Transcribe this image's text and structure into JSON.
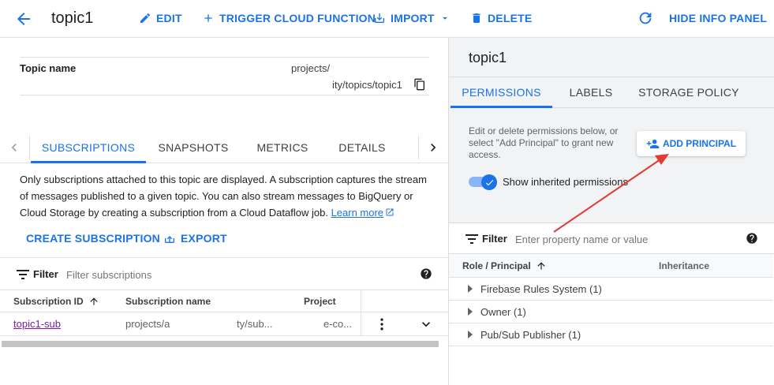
{
  "header": {
    "title": "topic1",
    "edit_label": "EDIT",
    "trigger_label": "TRIGGER CLOUD FUNCTION",
    "import_label": "IMPORT",
    "delete_label": "DELETE",
    "hide_info_label": "HIDE INFO PANEL"
  },
  "topic": {
    "name_label": "Topic name",
    "path_line1": "projects/",
    "path_line2": "ity/topics/topic1"
  },
  "tabs": [
    {
      "label": "SUBSCRIPTIONS"
    },
    {
      "label": "SNAPSHOTS"
    },
    {
      "label": "METRICS"
    },
    {
      "label": "DETAILS"
    }
  ],
  "subscriptions": {
    "description": "Only subscriptions attached to this topic are displayed. A subscription captures the stream of messages published to a given topic. You can also stream messages to BigQuery or Cloud Storage by creating a subscription from a Cloud Dataflow job.",
    "learn_more": "Learn more",
    "create_label": "CREATE SUBSCRIPTION",
    "export_label": "EXPORT",
    "filter_label": "Filter",
    "filter_placeholder": "Filter subscriptions",
    "columns": {
      "id": "Subscription ID",
      "name": "Subscription name",
      "project": "Project"
    },
    "rows": [
      {
        "id": "topic1-sub",
        "name_a": "projects/a",
        "name_b": "ty/sub...",
        "project": "e-co..."
      }
    ]
  },
  "panel": {
    "title": "topic1",
    "tabs": [
      {
        "label": "PERMISSIONS"
      },
      {
        "label": "LABELS"
      },
      {
        "label": "STORAGE POLICY"
      }
    ],
    "help_text": "Edit or delete permissions below, or select \"Add Principal\" to grant new access.",
    "add_principal_label": "ADD PRINCIPAL",
    "show_inherited_label": "Show inherited permissions",
    "show_inherited_on": true,
    "filter_label": "Filter",
    "filter_placeholder": "Enter property name or value",
    "columns": {
      "role": "Role / Principal",
      "inheritance": "Inheritance"
    },
    "roles": [
      {
        "label": "Firebase Rules System (1)"
      },
      {
        "label": "Owner (1)"
      },
      {
        "label": "Pub/Sub Publisher (1)"
      }
    ]
  },
  "colors": {
    "accent": "#1a73e8",
    "annotation_arrow": "#e53935",
    "visited_link": "#7b1fa2"
  }
}
